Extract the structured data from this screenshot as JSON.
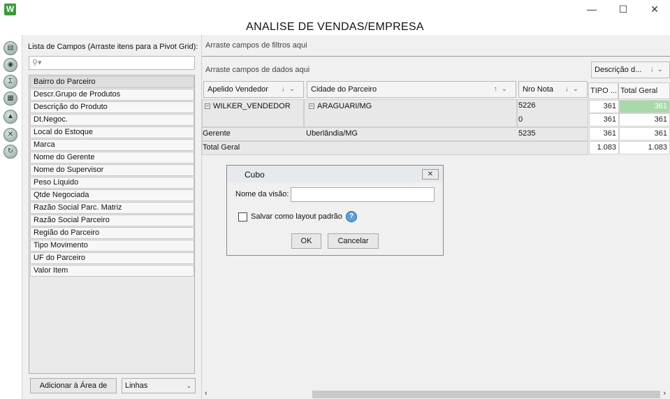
{
  "window": {
    "logo": "W",
    "title": "ANALISE DE VENDAS/EMPRESA",
    "minimize_icon": "minimize-icon",
    "maximize_icon": "maximize-icon",
    "close_icon": "close-icon"
  },
  "toolstrip": {
    "tools": [
      "export-icon",
      "camera-icon",
      "sum-icon",
      "grid-icon",
      "import-icon",
      "expand-icon",
      "refresh-icon"
    ]
  },
  "field_list": {
    "label": "Lista de Campos (Arraste itens para a Pivot Grid):",
    "search_placeholder": "",
    "items": [
      "Bairro do Parceiro",
      "Descr.Grupo de Produtos",
      "Descrição do Produto",
      "Dt.Negoc.",
      "Local do Estoque",
      "Marca",
      "Nome do Gerente",
      "Nome do Supervisor",
      "Peso Líquido",
      "Qtde Negociada",
      "Razão Social Parc. Matriz",
      "Razão Social Parceiro",
      "Região do Parceiro",
      "Tipo Movimento",
      "UF do Parceiro",
      "Valor Item"
    ],
    "add_button": "Adicionar à Área de",
    "area_select": "Linhas"
  },
  "pivot": {
    "filter_hint": "Arraste campos de filtros aqui",
    "data_hint": "Arraste campos de dados aqui",
    "column_field": "Descrição d...",
    "row_fields": [
      "Apelido Vendedor",
      "Cidade do Parceiro",
      "Nro Nota"
    ],
    "column_headers": [
      "TIPO ...",
      "Total Geral"
    ],
    "rows": [
      {
        "vendedor": "WILKER_VENDEDOR",
        "cidade": "ARAGUARI/MG",
        "nota": "5226",
        "tipo": "361",
        "total": "361"
      },
      {
        "vendedor": "",
        "cidade": "",
        "nota": "0",
        "tipo": "361",
        "total": "361"
      },
      {
        "vendedor": "Gerente",
        "cidade": "Uberlândia/MG",
        "nota": "5235",
        "tipo": "361",
        "total": "361"
      }
    ],
    "grand_total": {
      "label": "Total Geral",
      "tipo": "1.083",
      "total": "1.083"
    },
    "expand_symbol": "−"
  },
  "dialog": {
    "title": "Cubo",
    "close_symbol": "✕",
    "view_name_label": "Nome da visão:",
    "view_name_value": "",
    "save_default_label": "Salvar como layout padrão",
    "save_default_checked": false,
    "help_symbol": "?",
    "ok_label": "OK",
    "cancel_label": "Cancelar"
  },
  "colors": {
    "highlight_cell": "#a9d8a9",
    "logo_green": "#3d9a3d"
  }
}
